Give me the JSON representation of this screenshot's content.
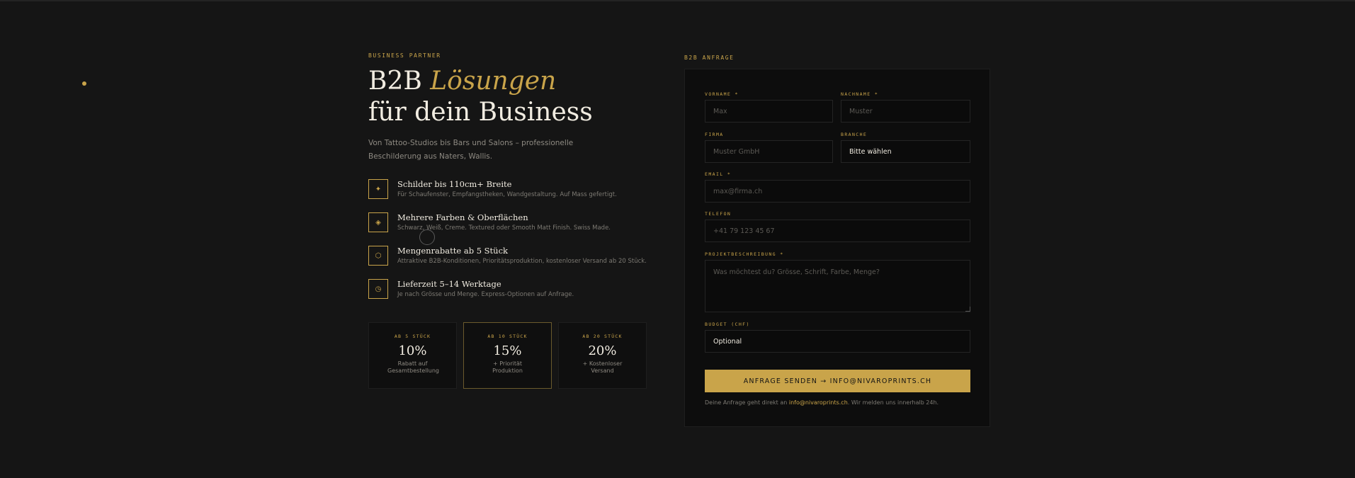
{
  "left": {
    "eyebrow": "BUSINESS PARTNER",
    "title_part1": "B2B ",
    "title_accent": "Lösungen",
    "title_line2": "für dein Business",
    "lead": "Von Tattoo-Studios bis Bars und Salons – professionelle Beschilderung aus Naters, Wallis.",
    "features": [
      {
        "icon": "✦",
        "title": "Schilder bis 110cm+ Breite",
        "desc": "Für Schaufenster, Empfangstheken, Wandgestaltung. Auf Mass gefertigt."
      },
      {
        "icon": "◈",
        "title": "Mehrere Farben & Oberflächen",
        "desc": "Schwarz, Weiß, Creme. Textured oder Smooth Matt Finish. Swiss Made."
      },
      {
        "icon": "⬡",
        "title": "Mengenrabatte ab 5 Stück",
        "desc": "Attraktive B2B-Konditionen, Prioritätsproduktion, kostenloser Versand ab 20 Stück."
      },
      {
        "icon": "◷",
        "title": "Lieferzeit 5–14 Werktage",
        "desc": "Je nach Grösse und Menge. Express-Optionen auf Anfrage."
      }
    ],
    "tiers": [
      {
        "label": "AB 5 STÜCK",
        "pct": "10%",
        "desc": "Rabatt auf Gesamtbestellung"
      },
      {
        "label": "AB 10 STÜCK",
        "pct": "15%",
        "desc": "+ Priorität Produktion"
      },
      {
        "label": "AB 20 STÜCK",
        "pct": "20%",
        "desc": "+ Kostenloser Versand"
      }
    ]
  },
  "form": {
    "eyebrow": "B2B ANFRAGE",
    "vorname": {
      "label": "VORNAME *",
      "placeholder": "Max"
    },
    "nachname": {
      "label": "NACHNAME *",
      "placeholder": "Muster"
    },
    "firma": {
      "label": "FIRMA",
      "placeholder": "Muster GmbH"
    },
    "branche": {
      "label": "BRANCHE",
      "value": "Bitte wählen"
    },
    "email": {
      "label": "EMAIL *",
      "placeholder": "max@firma.ch"
    },
    "telefon": {
      "label": "TELEFON",
      "placeholder": "+41 79 123 45 67"
    },
    "projekt": {
      "label": "PROJEKTBESCHREIBUNG *",
      "placeholder": "Was möchtest du? Grösse, Schrift, Farbe, Menge?"
    },
    "budget": {
      "label": "BUDGET (CHF)",
      "value": "Optional"
    },
    "submit_label": "ANFRAGE SENDEN → INFO@NIVAROPRINTS.CH",
    "note_prefix": "Deine Anfrage geht direkt an ",
    "note_email": "info@nivaroprints.ch",
    "note_suffix": ". Wir melden uns innerhalb 24h."
  },
  "colors": {
    "accent": "#c9a44a",
    "background": "#151515",
    "panel": "#0d0d0d"
  }
}
